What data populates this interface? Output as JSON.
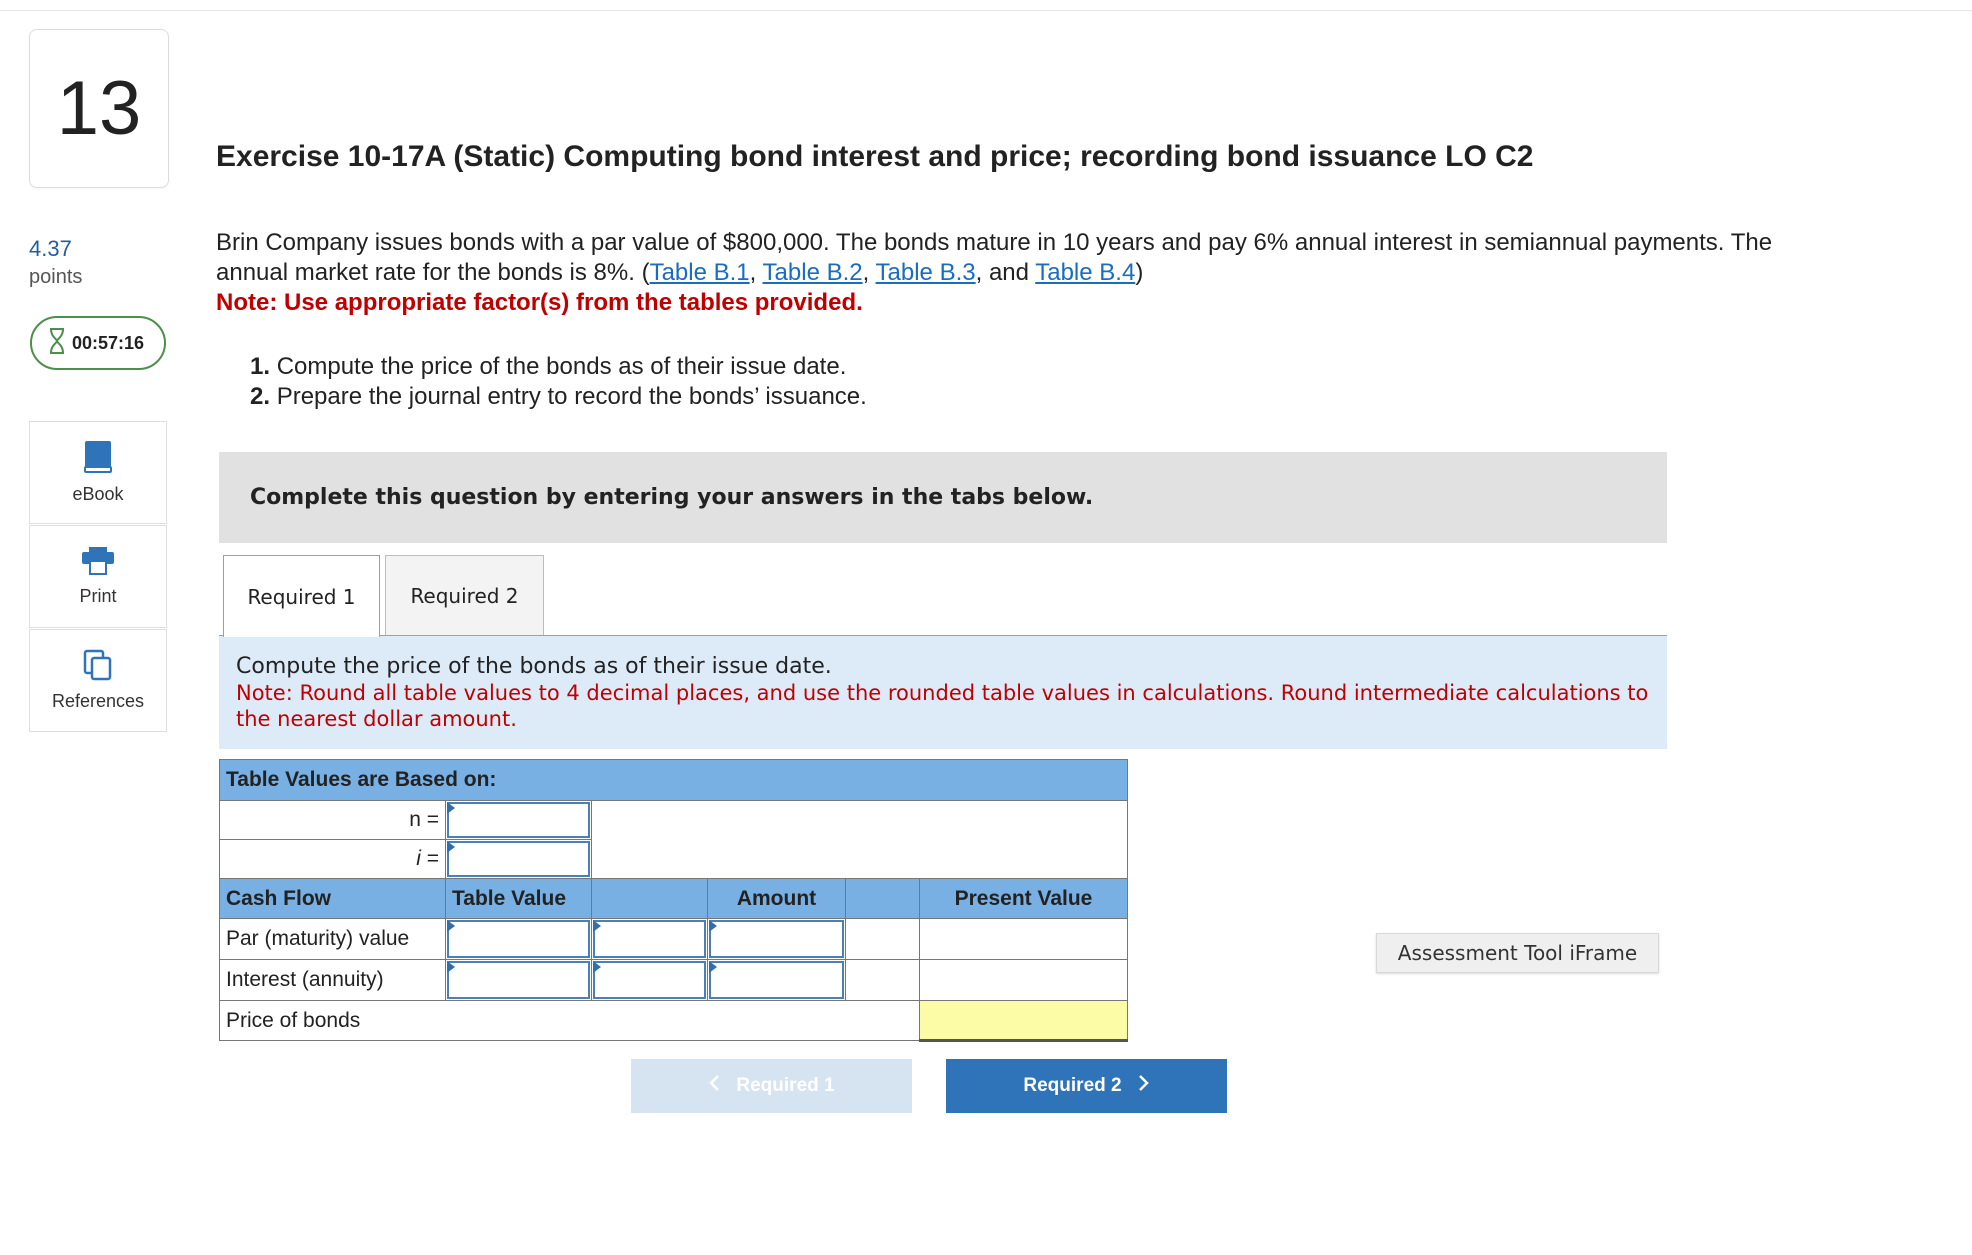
{
  "question": {
    "number": "13",
    "points_value": "4.37",
    "points_label": "points",
    "timer": "00:57:16"
  },
  "sidebar": {
    "tools": [
      {
        "label": "eBook"
      },
      {
        "label": "Print"
      },
      {
        "label": "References"
      }
    ]
  },
  "exercise": {
    "title": "Exercise 10-17A (Static) Computing bond interest and price; recording bond issuance LO C2",
    "text_part1": "Brin Company issues bonds with a par value of $800,000. The bonds mature in 10 years and pay 6% annual interest in semiannual payments. The annual market rate for the bonds is 8%. (",
    "links": [
      "Table B.1",
      "Table B.2",
      "Table B.3",
      "Table B.4"
    ],
    "sep_comma": ", ",
    "sep_and": ", and ",
    "text_close": ")",
    "note": "Note: Use appropriate factor(s) from the tables provided.",
    "requirements": [
      {
        "num": "1.",
        "text": "Compute the price of the bonds as of their issue date."
      },
      {
        "num": "2.",
        "text": "Prepare the journal entry to record the bonds’ issuance."
      }
    ]
  },
  "complete_box": "Complete this question by entering your answers in the tabs below.",
  "tabs": [
    {
      "label": "Required 1",
      "active": true
    },
    {
      "label": "Required 2",
      "active": false
    }
  ],
  "instruction": {
    "line1": "Compute the price of the bonds as of their issue date.",
    "line2": "Note: Round all table values to 4 decimal places, and use the rounded table values in calculations. Round intermediate calculations to the nearest dollar amount."
  },
  "table": {
    "based_on_label": "Table Values are Based on:",
    "n_label": "n =",
    "i_label": "i",
    "i_eq": " =",
    "headers": {
      "cash_flow": "Cash Flow",
      "table_value": "Table Value",
      "amount": "Amount",
      "present_value": "Present Value"
    },
    "rows": [
      {
        "label": "Par (maturity) value"
      },
      {
        "label": "Interest (annuity)"
      },
      {
        "label": "Price of bonds"
      }
    ]
  },
  "assessment_tool": "Assessment Tool iFrame",
  "nav": {
    "prev_label": "Required 1",
    "next_label": "Required 2"
  },
  "colors": {
    "link": "#1a6cc0",
    "note_red": "#c00000",
    "table_header": "#78b0e4",
    "instruction_bg": "#ddebf8",
    "next_button": "#2f74b8",
    "prev_button": "#d6e4f2",
    "timer_border": "#4a8f4a"
  }
}
